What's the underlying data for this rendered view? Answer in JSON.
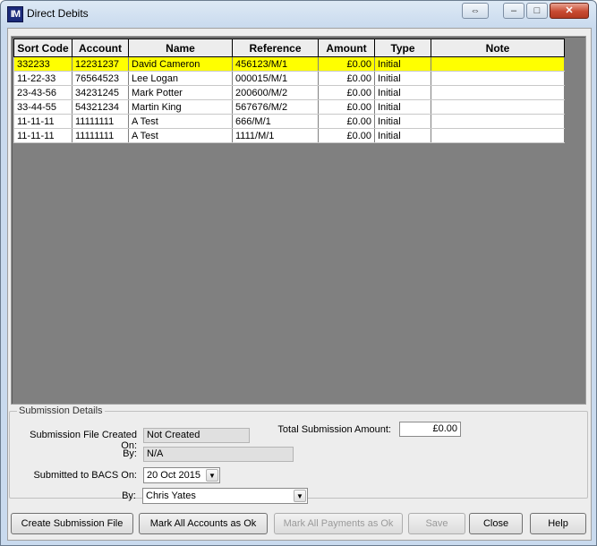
{
  "window": {
    "title": "Direct Debits",
    "app_icon_text": "IM",
    "controls": {
      "restore_glyph": "⇔",
      "minimize_glyph": "–",
      "maximize_glyph": "□",
      "close_glyph": "✕"
    }
  },
  "grid": {
    "columns": [
      "Sort Code",
      "Account",
      "Name",
      "Reference",
      "Amount",
      "Type",
      "Note"
    ],
    "rows": [
      {
        "sort_code": "332233",
        "account": "12231237",
        "name": "David Cameron",
        "reference": "456123/M/1",
        "amount": "£0.00",
        "type": "Initial",
        "note": ""
      },
      {
        "sort_code": "11-22-33",
        "account": "76564523",
        "name": "Lee Logan",
        "reference": "000015/M/1",
        "amount": "£0.00",
        "type": "Initial",
        "note": ""
      },
      {
        "sort_code": "23-43-56",
        "account": "34231245",
        "name": "Mark Potter",
        "reference": "200600/M/2",
        "amount": "£0.00",
        "type": "Initial",
        "note": ""
      },
      {
        "sort_code": "33-44-55",
        "account": "54321234",
        "name": "Martin King",
        "reference": "567676/M/2",
        "amount": "£0.00",
        "type": "Initial",
        "note": ""
      },
      {
        "sort_code": "11-11-11",
        "account": "11111111",
        "name": "A Test",
        "reference": "666/M/1",
        "amount": "£0.00",
        "type": "Initial",
        "note": ""
      },
      {
        "sort_code": "11-11-11",
        "account": "11111111",
        "name": "A Test",
        "reference": "1111/M/1",
        "amount": "£0.00",
        "type": "Initial",
        "note": ""
      }
    ],
    "selected_row_color": "#ffff00"
  },
  "submission": {
    "legend": "Submission Details",
    "file_created_label": "Submission File Created On:",
    "file_created_value": "Not Created",
    "by_label": "By:",
    "by_value": "N/A",
    "total_label": "Total Submission Amount:",
    "total_value": "£0.00",
    "submitted_label": "Submitted to BACS On:",
    "submitted_value": "20 Oct  2015",
    "submitted_by_label": "By:",
    "submitted_by_value": "Chris Yates"
  },
  "buttons": {
    "create_file": "Create Submission File",
    "mark_accounts_ok": "Mark All Accounts as Ok",
    "mark_payments_ok": "Mark All Payments as Ok",
    "save": "Save",
    "close": "Close",
    "help": "Help"
  }
}
